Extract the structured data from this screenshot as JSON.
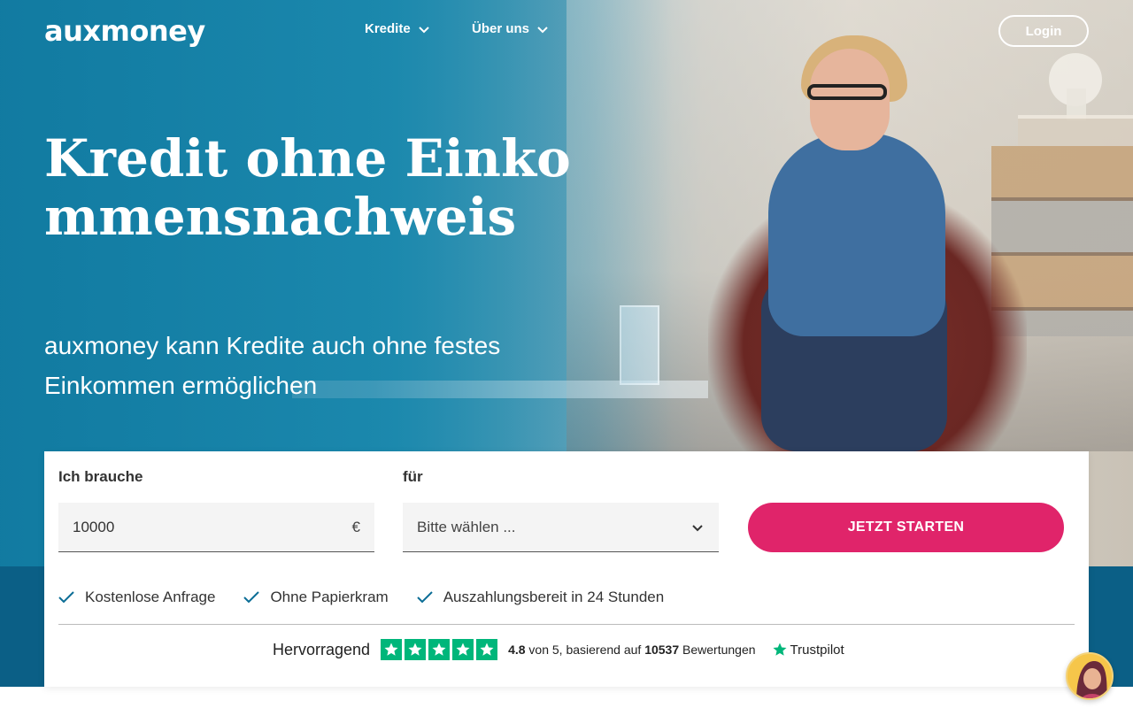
{
  "header": {
    "logo": "auxmoney",
    "nav": [
      {
        "label": "Kredite",
        "icon": "chevron-down-icon"
      },
      {
        "label": "Über uns",
        "icon": "chevron-down-icon"
      }
    ],
    "login_label": "Login"
  },
  "hero": {
    "title": "Kredit ohne Einkommensnachweis",
    "subtitle": "auxmoney kann Kredite auch ohne festes Einkommen ermöglichen"
  },
  "form": {
    "amount_label": "Ich brauche",
    "amount_value": "10000",
    "currency": "€",
    "purpose_label": "für",
    "purpose_placeholder": "Bitte wählen ...",
    "cta_label": "JETZT STARTEN"
  },
  "benefits": [
    "Kostenlose Anfrage",
    "Ohne Papierkram",
    "Auszahlungsbereit in 24 Stunden"
  ],
  "trustpilot": {
    "rating_word": "Hervorragend",
    "score": "4.8",
    "out_of": "von 5, basierend auf",
    "review_count": "10537",
    "reviews_word": "Bewertungen",
    "brand": "Trustpilot",
    "stars": 5
  },
  "colors": {
    "accent": "#e0246a",
    "brand_blue": "#0b5f86",
    "trustpilot_green": "#00b67a"
  }
}
